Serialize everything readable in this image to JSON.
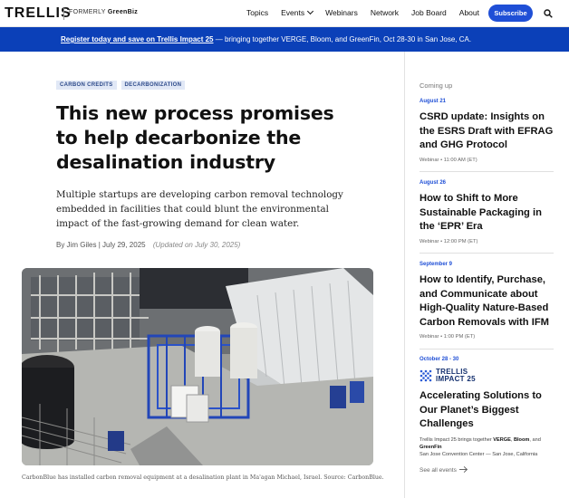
{
  "brand": {
    "logo": "TRELLIS",
    "formerly_prefix": "FORMERLY",
    "formerly_name": "GreenBiz"
  },
  "nav": {
    "items": [
      "Topics",
      "Events",
      "Webinars",
      "Network",
      "Job Board",
      "About"
    ],
    "subscribe_label": "Subscribe"
  },
  "banner": {
    "link_text": "Register today and save on Trellis Impact 25",
    "rest_text": " — bringing together VERGE, Bloom, and GreenFin, Oct 28-30 in San Jose, CA."
  },
  "article": {
    "tags": [
      "CARBON CREDITS",
      "DECARBONIZATION"
    ],
    "headline": "This new process promises to help decarbonize the desalination industry",
    "dek": "Multiple startups are developing carbon removal technology embedded in facilities that could blunt the environmental impact of the fast-growing demand for clean water.",
    "author": "By Jim Giles",
    "date": "July 29, 2025",
    "updated": "(Updated on July 30, 2025)",
    "caption": "CarbonBlue has installed carbon removal equipment at a desalination plant in Ma'agan Michael, Israel. Source: CarbonBlue."
  },
  "sidebar": {
    "heading": "Coming up",
    "events": [
      {
        "date": "August 21",
        "title": "CSRD update: Insights on the ESRS Draft with EFRAG and GHG Protocol",
        "meta": "Webinar • 11:00 AM (ET)"
      },
      {
        "date": "August 26",
        "title": "How to Shift to More Sustainable Packaging in the ‘EPR’ Era",
        "meta": "Webinar • 12:00 PM (ET)"
      },
      {
        "date": "September 9",
        "title": "How to Identify, Purchase, and Communicate about High-Quality Nature-Based Carbon Removals with IFM",
        "meta": "Webinar • 1:00 PM (ET)"
      }
    ],
    "feature": {
      "date": "October 28 - 30",
      "logo_line1": "TRELLIS",
      "logo_line2": "IMPACT 25",
      "title": "Accelerating Solutions to Our Planet’s Biggest Challenges",
      "desc_prefix": "Trellis Impact 25 brings together ",
      "desc_verge": "VERGE",
      "desc_comma": ", ",
      "desc_bloom": "Bloom",
      "desc_and": ", and ",
      "desc_greenfin": "GreenFin",
      "venue": "San Jose Convention Center — San Jose, California"
    },
    "see_all": "See all events"
  },
  "colors": {
    "accent": "#1f4fd6",
    "banner": "#0b40b8",
    "tag_bg": "#e1e8f6"
  }
}
